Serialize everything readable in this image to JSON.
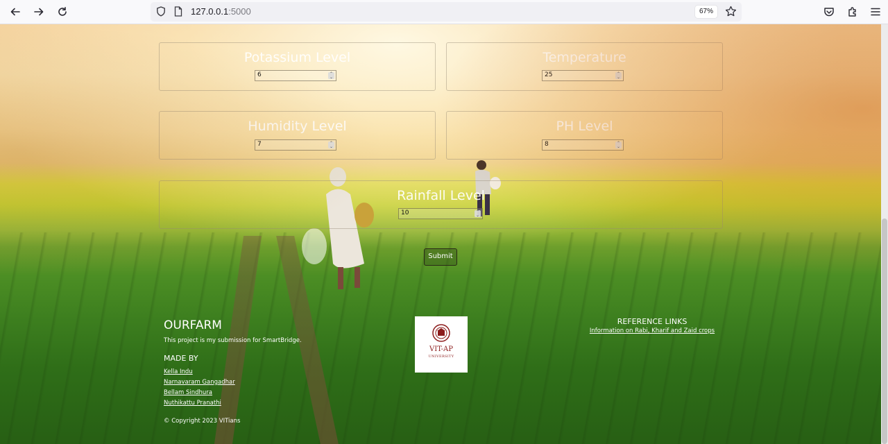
{
  "browser": {
    "url_host": "127.0.0.1",
    "url_port": ":5000",
    "zoom": "67%"
  },
  "form": {
    "fields": [
      {
        "label": "Potassium Level",
        "value": "6"
      },
      {
        "label": "Temperature",
        "value": "25"
      },
      {
        "label": "Humidity Level",
        "value": "7"
      },
      {
        "label": "PH Level",
        "value": "8"
      },
      {
        "label": "Rainfall Level",
        "value": "10"
      }
    ],
    "submit_label": "Submit"
  },
  "footer": {
    "title": "OURFARM",
    "description": "This project is my submission for SmartBridge.",
    "made_by_heading": "MADE BY",
    "members": [
      "Kella Indu",
      "Narnavaram Gangadhar",
      "Bellam Sindhura",
      "Nuthikattu Pranathi"
    ],
    "copyright": "© Copyright 2023 VITians",
    "logo": {
      "name": "VIT-AP",
      "sub": "UNIVERSITY"
    },
    "reference_heading": "REFERENCE LINKS",
    "reference_link": "Information on Rabi, Kharif and Zaid crops"
  }
}
